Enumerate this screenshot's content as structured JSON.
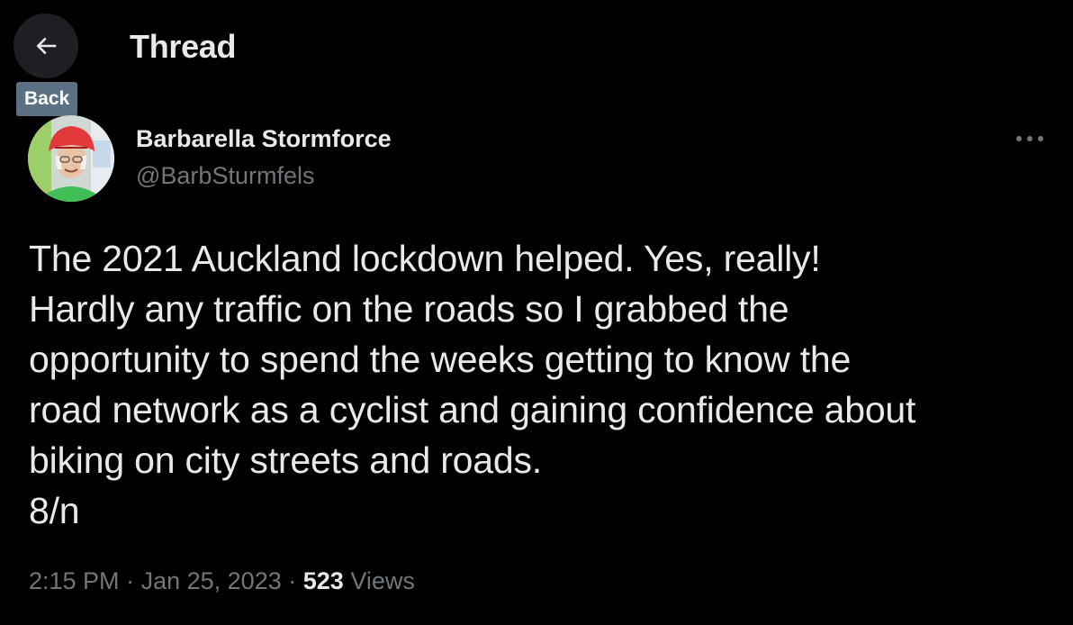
{
  "header": {
    "title": "Thread",
    "back_tooltip": "Back"
  },
  "tweet": {
    "author_name": "Barbarella Stormforce",
    "author_handle": "@BarbSturmfels",
    "text": "The 2021 Auckland lockdown helped. Yes, really!\nHardly any traffic on the roads so I grabbed the\nopportunity to spend the weeks getting to know the\nroad network as a cyclist and gaining confidence about\nbiking on city streets and roads.\n8/n",
    "time": "2:15 PM",
    "separator": "·",
    "date": "Jan 25, 2023",
    "views_count": "523",
    "views_label": "Views"
  },
  "icons": {
    "back": "arrow-left-icon",
    "more": "more-horizontal-icon"
  },
  "colors": {
    "background": "#000000",
    "text_primary": "#e7e9ea",
    "text_secondary": "#71767b",
    "tooltip_bg": "#5b7083",
    "back_button_bg": "#1d1f23"
  }
}
